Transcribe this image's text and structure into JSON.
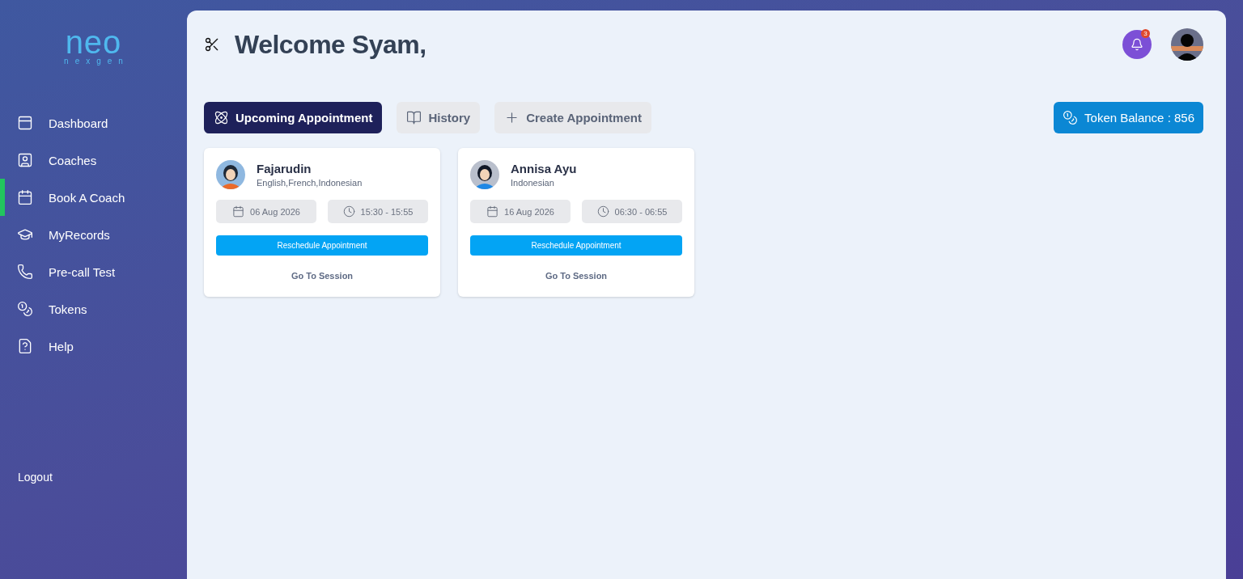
{
  "logo": {
    "mark": "neo",
    "tagline": "nexgen"
  },
  "sidebar": {
    "items": [
      {
        "label": "Dashboard",
        "selected": false
      },
      {
        "label": "Coaches",
        "selected": false
      },
      {
        "label": "Book A Coach",
        "selected": true
      },
      {
        "label": "MyRecords",
        "selected": false
      },
      {
        "label": "Pre-call Test",
        "selected": false
      },
      {
        "label": "Tokens",
        "selected": false
      },
      {
        "label": "Help",
        "selected": false
      }
    ],
    "logout": "Logout"
  },
  "header": {
    "title": "Welcome Syam,",
    "notification_count": "3"
  },
  "tabs": [
    {
      "label": "Upcoming Appointment",
      "selected": true
    },
    {
      "label": "History",
      "selected": false
    },
    {
      "label": "Create Appointment",
      "selected": false
    }
  ],
  "token_balance": "Token Balance : 856",
  "appointments": [
    {
      "name": "Fajarudin",
      "languages": "English,French,Indonesian",
      "date": "06 Aug 2026",
      "time": "15:30 - 15:55",
      "reschedule": "Reschedule Appointment",
      "session": "Go To Session"
    },
    {
      "name": "Annisa Ayu",
      "languages": "Indonesian",
      "date": "16 Aug 2026",
      "time": "06:30 - 06:55",
      "reschedule": "Reschedule Appointment",
      "session": "Go To Session"
    }
  ]
}
